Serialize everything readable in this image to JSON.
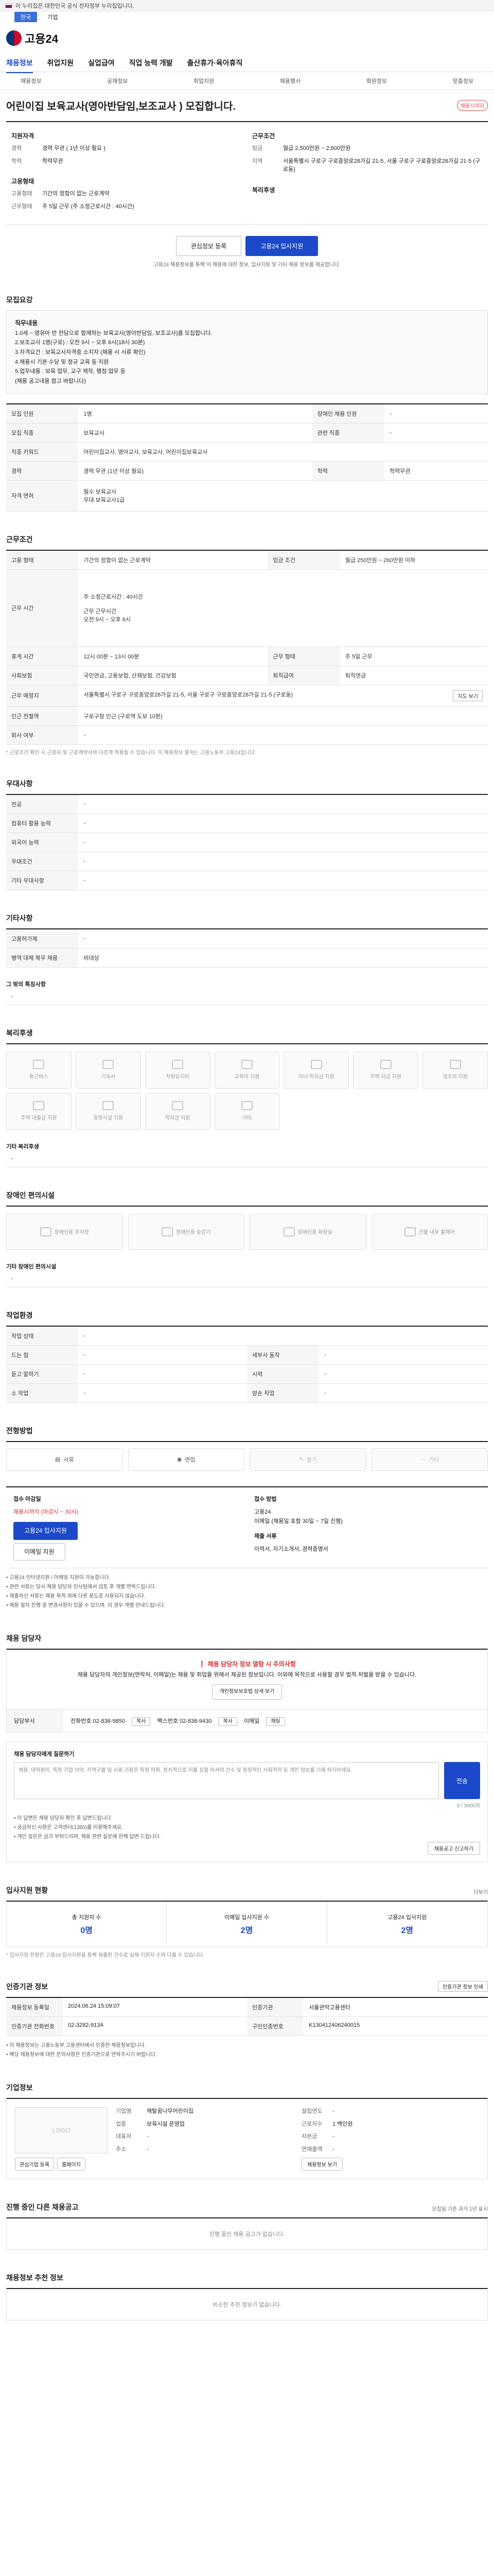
{
  "gov_banner": "이 누리집은 대한민국 공식 전자정부 누리집입니다.",
  "lang": [
    "한국",
    "기업"
  ],
  "logo_text": "고용24",
  "gnb": [
    "채용정보",
    "취업지원",
    "실업급여",
    "직업 능력 개발",
    "출산휴가·육아휴직"
  ],
  "subnav": [
    "채용정보",
    "공채정보",
    "취업지원",
    "채용행사",
    "회원정보",
    "맞춤정보"
  ],
  "company_name": "",
  "job_title": "어린이집 보육교사(영아반담임,보조교사 ) 모집합니다.",
  "badge": "채용시까지",
  "summary": {
    "left_title": "지원자격",
    "left": [
      {
        "k": "경력",
        "v": "경력 무관 ( 1년 이상 필요 )"
      },
      {
        "k": "학력",
        "v": "학력무관"
      }
    ],
    "left_title2": "고용형태",
    "left2": [
      {
        "k": "고용형태",
        "v": "기간의 정함이 없는 근로계약"
      },
      {
        "k": "근무형태",
        "v": "주 5일 근무 (주 소정근로시간 : 40시간)"
      }
    ],
    "right_title": "근무조건",
    "right": [
      {
        "k": "임금",
        "v": "월급 2,500만원 ~ 2,600만원"
      },
      {
        "k": "지역",
        "v": "서울특별시 구로구 구로중앙로28가길 21-5, 서울 구로구 구로중앙로28가길 21-5 (구로동)"
      }
    ],
    "right_title2": "복리후생"
  },
  "cta": {
    "save": "관심정보 등록",
    "apply": "고용24 입사지원",
    "note": "고용24 채용정보를 통해 이 채용에 대한 정보, 입사지원 및 기타 채용 정보를 제공합니다."
  },
  "job_detail": {
    "title": "모집요강",
    "heading": "직무내용",
    "lines": [
      "1.0세 ~ 영유아 반 전담으로 함께하는 보육교사(영아반담임, 보조교사)를 모집합니다.",
      "2.보조교사 1명(구로) : 오전 9시 ~ 오후 6시(18시 30분)",
      "",
      "3.자격요건 : 보육교사자격증 소지자 (채용 시 서류 확인)",
      "4.채용시 기본 수당 및 정규 교육 등 지원",
      "5.업무내용 : 보육 업무, 교구 제작, 행정 업무 등",
      "(채용 공고내용 참고 바랍니다)"
    ]
  },
  "req_table": [
    [
      "모집 인원",
      "1명",
      "장애인 채용 인원",
      "-"
    ],
    [
      "모집 직종",
      "보육교사",
      "관련 직종",
      "-"
    ],
    [
      "직종 키워드",
      "어린이집교사, 영아교사, 보육교사, 어린이집보육교사",
      "",
      ""
    ],
    [
      "경력",
      "경력 무관 (1년 이상 필요)",
      "학력",
      "학력무관"
    ],
    [
      "자격 면허",
      "필수 보육교사\n우대 보육교사1급",
      "",
      ""
    ]
  ],
  "cond": {
    "title": "근무조건",
    "rows": [
      [
        "고용 형태",
        "기간의 정함이 없는 근로계약",
        "임금 조건",
        "월급 250만원 ~ 260만원 이하"
      ],
      [
        "근무 시간",
        "주 소정근로시간 : 40시간\n\n근무 근무시간\n오전 9시 ~ 오후 6시",
        "",
        ""
      ],
      [
        "휴게 시간",
        "12시 00분 ~ 13시 00분",
        "근무 형태",
        "주 5일 근무"
      ],
      [
        "사회보험",
        "국민연금, 고용보험, 산재보험, 건강보험",
        "퇴직급여",
        "퇴직연금"
      ],
      [
        "근무 예정지",
        "서울특별시 구로구 구로중앙로28가길 21-5, 서울 구로구 구로중앙로28가길 21-5 (구로동)",
        "",
        ""
      ],
      [
        "인근 전철역",
        "구로구청 인근 (구로역 도보 10분)",
        "",
        ""
      ],
      [
        "퇴사 여부",
        "-",
        "",
        ""
      ]
    ],
    "note": "* 근로조건 확인 시 근로자 및 근로계약서와 다르게 적용될 수 있습니다. 이 채용정보 출처는 고용노동부 고용24입니다.",
    "map_btn": "지도 보기"
  },
  "pref": {
    "title": "우대사항",
    "rows": [
      [
        "전공",
        "-"
      ],
      [
        "컴퓨터 활용 능력",
        "-"
      ],
      [
        "외국어 능력",
        "-"
      ],
      [
        "우대조건",
        "-"
      ],
      [
        "기타 우대사항",
        "-"
      ]
    ]
  },
  "etc": {
    "title": "기타사항",
    "rows": [
      [
        "고용허가제",
        "-"
      ],
      [
        "병역 대체 복무 채용",
        "비대상"
      ]
    ],
    "sub_title": "그 밖의 특징사항",
    "sub_value": "-"
  },
  "welfare": {
    "title": "복리후생",
    "items": [
      "통근버스",
      "기숙사",
      "차량유지비",
      "교육비 지원",
      "자녀 학자금 지원",
      "주택 자금 지원",
      "경조비 지원",
      "주택 대출금 지원",
      "휴양시설 지원",
      "학자금 지원",
      "기타"
    ],
    "other_title": "기타 복리후생",
    "other_value": "-"
  },
  "facility": {
    "title": "장애인 편의시설",
    "items": [
      "장애인용 주차장",
      "장애인용 승강기",
      "장애인용 화장실",
      "건물 내부 휠체어"
    ],
    "other_title": "기타 장애인 편의시설",
    "other_value": "-"
  },
  "workplace": {
    "title": "작업환경",
    "rows": [
      [
        "작업 상태",
        "-",
        "",
        ""
      ],
      [
        "드는 힘",
        "-",
        "세부사 동작",
        "-"
      ],
      [
        "듣고 말하기",
        "-",
        "시력",
        "-"
      ],
      [
        "소 작업",
        "-",
        "양손 작업",
        "-"
      ]
    ]
  },
  "process": {
    "title": "전형방법",
    "steps": [
      "서류",
      "면접",
      "필기",
      "기타"
    ]
  },
  "apply": {
    "h1": "접수 마감일",
    "deadline": "채용시까지 (마감시 ~ 30시)",
    "apply_btn": "고용24 입사지원",
    "email_btn": "이메일 지원",
    "h2": "접수 방법",
    "method": "고용24\n이메일 (채용일 포함 30일 ~ 7일 진행)",
    "h3": "제출 서류",
    "docs": "이력서, 자기소개서, 경력증명서",
    "notes": [
      "• 고용24 인터넷지원 / 이메일 지원이 가능합니다.",
      "• 관련 서류는 당사 채용 담당자 인사팀에서 검토 후 개별 연락드립니다.",
      "• 제출하신 서류는 채용 목적 외에 다른 용도로 사용되지 않습니다.",
      "• 채용 절차 진행 중 변경사항이 있을 수 있으며, 이 경우 개별 안내드립니다."
    ]
  },
  "contact": {
    "title": "채용 담당자",
    "warn_title": "채용 담당자 정보 열람 시 주의사항",
    "warn_text": "채용 담당자의 개인정보(연락처, 이메일)는 채용 및 취업을 위해서 제공된 정보입니다. 이외에 목적으로 사용할 경우 법적 처벌을 받을 수 있습니다.",
    "warn_btn": "개인정보보호법 상세 보기",
    "name_label": "담당부서",
    "phone_label": "전화번호",
    "phone": "02-838-9850",
    "fax_label": "팩스번호",
    "fax": "02-838-9430",
    "email_label": "이메일",
    "copy": "복사",
    "chat": "채팅"
  },
  "qa": {
    "title": "채용 담당자에게 질문하기",
    "placeholder": "채용, 대학원이, 특정 기업 이야, 지역구를 일 사회 가용은 특정 어휘, 정치적으로 이를 포함 하셔야 건수 및 정정적인 사회적의 등 개인 정보를 기재 하지마세요.",
    "counter": "0 / 3000자",
    "send": "전송",
    "notes": [
      "• 이 답변은 채용 담당자 확인 후 답변드립니다.",
      "• 궁금하신 사항은 고객센터(1350)를 이용해주세요.",
      "• 개인 질문은 삼가 부탁드리며, 채용 관련 질문에 한해 답변 드립니다."
    ],
    "report_btn": "채용공고 신고하기"
  },
  "stats": {
    "title": "입사지원 현황",
    "more": "더보기",
    "items": [
      {
        "label": "총 지원자 수",
        "value": "0명"
      },
      {
        "label": "이메일 입사지원 수",
        "value": "2명"
      },
      {
        "label": "고용24 입사지원",
        "value": "2명"
      }
    ],
    "note": "* 입사지원 현황은 고용24 입사지원을 통해 제출된 건수로 실제 지원자 수와 다를 수 있습니다."
  },
  "info": {
    "title": "인증기관 정보",
    "print_btn": "인증기관 정보 인쇄",
    "rows": [
      [
        "채용정보 등록일",
        "2024.06.24 15:09:07",
        "인증기관",
        "서울관악고용센터"
      ],
      [
        "인증기관 전화번호",
        "02-3282-9134",
        "구인인증번호",
        "K130412406240015"
      ]
    ],
    "notes": [
      "• 이 채용정보는 고용노동부 고용센터에서 인증한 채용정보입니다.",
      "• 해당 채용정보에 대한 문의사항은 인증기관으로 연락주시기 바랍니다."
    ]
  },
  "company": {
    "title": "기업정보",
    "logo": "LOGO",
    "btn1": "관심기업 등록",
    "btn2": "홈페이지",
    "rows_left": [
      [
        "기업명",
        "해탈꿈나무어린이집"
      ],
      [
        "업종",
        "보육시설 운영업"
      ],
      [
        "대표자",
        "-"
      ],
      [
        "주소",
        "-"
      ]
    ],
    "rows_right": [
      [
        "설립연도",
        "-"
      ],
      [
        "근로자수",
        "1 백인원"
      ],
      [
        "자본금",
        "-"
      ],
      [
        "연매출액",
        "-"
      ]
    ],
    "detail_btn": "채용정보 보기"
  },
  "same_co": {
    "title": "진행 중인 다른 채용공고",
    "more": "모집일 기준 과거 1년 표시",
    "empty": "진행 중인 채용 공고가 없습니다."
  },
  "recommend": {
    "title": "채용정보 추천 정보",
    "empty": "비슷한 추천 정보가 없습니다."
  }
}
